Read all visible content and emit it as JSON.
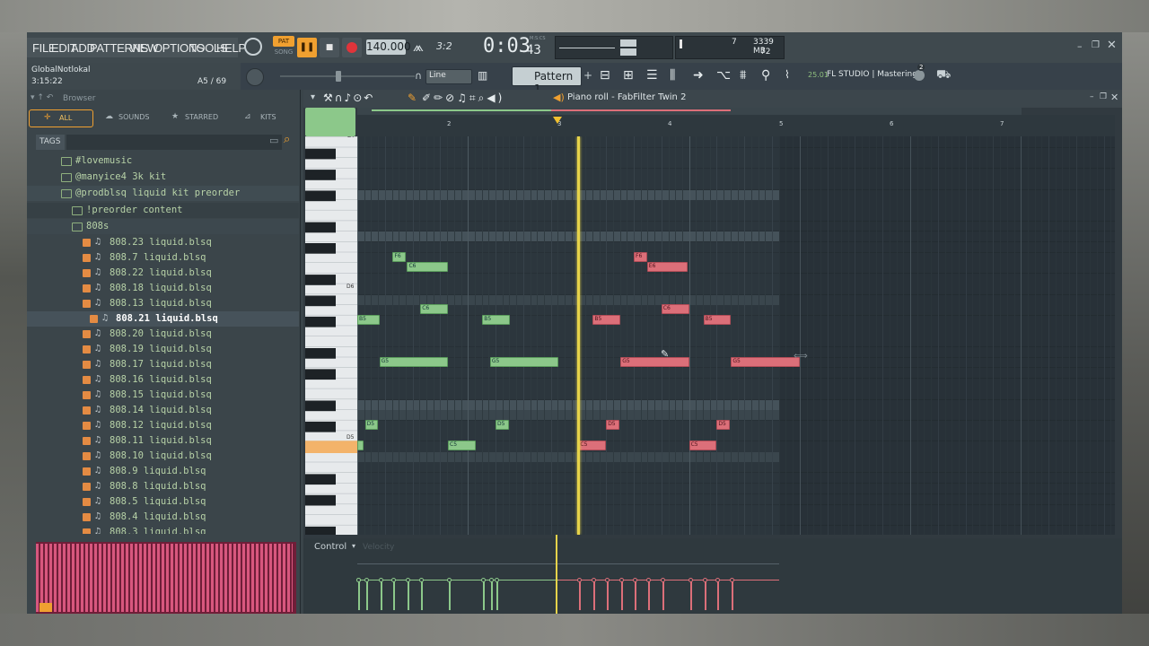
{
  "menu": [
    "FILE",
    "EDIT",
    "ADD",
    "PATTERNS",
    "VIEW",
    "OPTIONS",
    "TOOLS",
    "HELP"
  ],
  "transport": {
    "pat_label": "PAT",
    "song_label": "SONG",
    "tempo": "140.000",
    "beat_display": "3:2",
    "time": "0:03",
    "time_small": "43",
    "time_unit": "M:S:CS",
    "cpu_value": "7",
    "memory": "3339 MB",
    "polyphony": "72"
  },
  "hint": {
    "project": "GlobalNotlokal",
    "time": "3:15:22",
    "note_counter": "A5 / 69"
  },
  "toolbar": {
    "snap": "Line",
    "pattern": "Pattern 1",
    "version": "25.01",
    "studio_label": "FL STUDIO | Mastering",
    "badge": "2"
  },
  "browser": {
    "title": "Browser",
    "tabs": [
      "ALL",
      "SOUNDS",
      "STARRED",
      "KITS"
    ],
    "tags_label": "TAGS",
    "folders": [
      "#lovemusic",
      "@manyice4 3k kit",
      "@prodblsq liquid kit preorder",
      "!preorder content",
      "808s"
    ],
    "files": [
      "808.23 liquid.blsq",
      "808.7 liquid.blsq",
      "808.22 liquid.blsq",
      "808.18 liquid.blsq",
      "808.13 liquid.blsq",
      "808.21 liquid.blsq",
      "808.20 liquid.blsq",
      "808.19 liquid.blsq",
      "808.17 liquid.blsq",
      "808.16 liquid.blsq",
      "808.15 liquid.blsq",
      "808.14 liquid.blsq",
      "808.12 liquid.blsq",
      "808.11 liquid.blsq",
      "808.10 liquid.blsq",
      "808.9 liquid.blsq",
      "808.8 liquid.blsq",
      "808.5 liquid.blsq",
      "808.4 liquid.blsq",
      "808.3 liquid.blsq"
    ],
    "selected_file": "808.21 liquid.blsq"
  },
  "piano_roll": {
    "title": "Piano roll - FabFilter Twin 2",
    "bars": [
      "2",
      "3",
      "4",
      "5",
      "6",
      "7"
    ],
    "key_labels": [
      "D7",
      "D6",
      "D5"
    ],
    "control_label": "Control",
    "control_param": "Velocity",
    "playhead_bar": 3.0,
    "notes": [
      {
        "label": "F6",
        "bar": 1.32,
        "len": 0.12,
        "row": 11,
        "color": "green"
      },
      {
        "label": "C6",
        "bar": 1.45,
        "len": 0.37,
        "row": 12,
        "color": "green"
      },
      {
        "label": "F6",
        "bar": 3.5,
        "len": 0.12,
        "row": 11,
        "color": "red"
      },
      {
        "label": "E6",
        "bar": 3.62,
        "len": 0.37,
        "row": 12,
        "color": "red"
      },
      {
        "label": "C6",
        "bar": 1.57,
        "len": 0.25,
        "row": 16,
        "color": "green"
      },
      {
        "label": "C6",
        "bar": 3.75,
        "len": 0.25,
        "row": 16,
        "color": "red"
      },
      {
        "label": "B5",
        "bar": 1.0,
        "len": 0.2,
        "row": 17,
        "color": "green"
      },
      {
        "label": "B5",
        "bar": 2.13,
        "len": 0.25,
        "row": 17,
        "color": "green"
      },
      {
        "label": "B5",
        "bar": 3.13,
        "len": 0.25,
        "row": 17,
        "color": "red"
      },
      {
        "label": "B5",
        "bar": 4.13,
        "len": 0.25,
        "row": 17,
        "color": "red"
      },
      {
        "label": "G5",
        "bar": 1.2,
        "len": 0.62,
        "row": 21,
        "color": "green"
      },
      {
        "label": "G5",
        "bar": 2.2,
        "len": 0.62,
        "row": 21,
        "color": "green"
      },
      {
        "label": "G5",
        "bar": 3.38,
        "len": 0.62,
        "row": 21,
        "color": "red"
      },
      {
        "label": "G5",
        "bar": 4.38,
        "len": 0.62,
        "row": 21,
        "color": "red"
      },
      {
        "label": "D5",
        "bar": 1.07,
        "len": 0.12,
        "row": 27,
        "color": "green"
      },
      {
        "label": "D5",
        "bar": 2.25,
        "len": 0.12,
        "row": 27,
        "color": "green"
      },
      {
        "label": "D5",
        "bar": 3.25,
        "len": 0.12,
        "row": 27,
        "color": "red"
      },
      {
        "label": "D5",
        "bar": 4.25,
        "len": 0.12,
        "row": 27,
        "color": "red"
      },
      {
        "label": "",
        "bar": 1.0,
        "len": 0.06,
        "row": 29,
        "color": "green"
      },
      {
        "label": "C5",
        "bar": 1.82,
        "len": 0.25,
        "row": 29,
        "color": "green"
      },
      {
        "label": "C5",
        "bar": 3.0,
        "len": 0.25,
        "row": 29,
        "color": "red"
      },
      {
        "label": "C5",
        "bar": 4.0,
        "len": 0.25,
        "row": 29,
        "color": "red"
      }
    ]
  },
  "colors": {
    "green_note": "#8cc88a",
    "red_note": "#dc6f79",
    "playhead": "#e6d34a",
    "accent_orange": "#f0a030"
  }
}
